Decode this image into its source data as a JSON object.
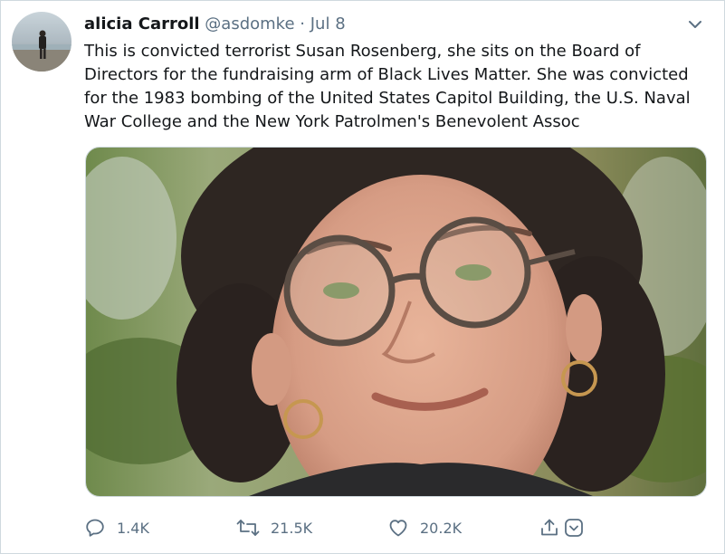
{
  "tweet": {
    "author_name": "alicia Carroll",
    "handle": "@asdomke",
    "separator": "·",
    "date": "Jul 8",
    "text": "This is convicted terrorist Susan Rosenberg, she sits on the Board of Directors for the fundraising arm of Black Lives Matter.  She was convicted for the 1983 bombing of the United States Capitol Building, the U.S. Naval War College and the New York Patrolmen's Benevolent Assoc"
  },
  "actions": {
    "replies": "1.4K",
    "retweets": "21.5K",
    "likes": "20.2K"
  },
  "icons": {
    "more": "chevron-down-icon",
    "reply": "reply-icon",
    "retweet": "retweet-icon",
    "like": "heart-icon",
    "share": "share-icon",
    "options": "chevron-circle-icon"
  },
  "colors": {
    "text": "#14171a",
    "secondary": "#5b7083",
    "border": "#cfd9de"
  }
}
